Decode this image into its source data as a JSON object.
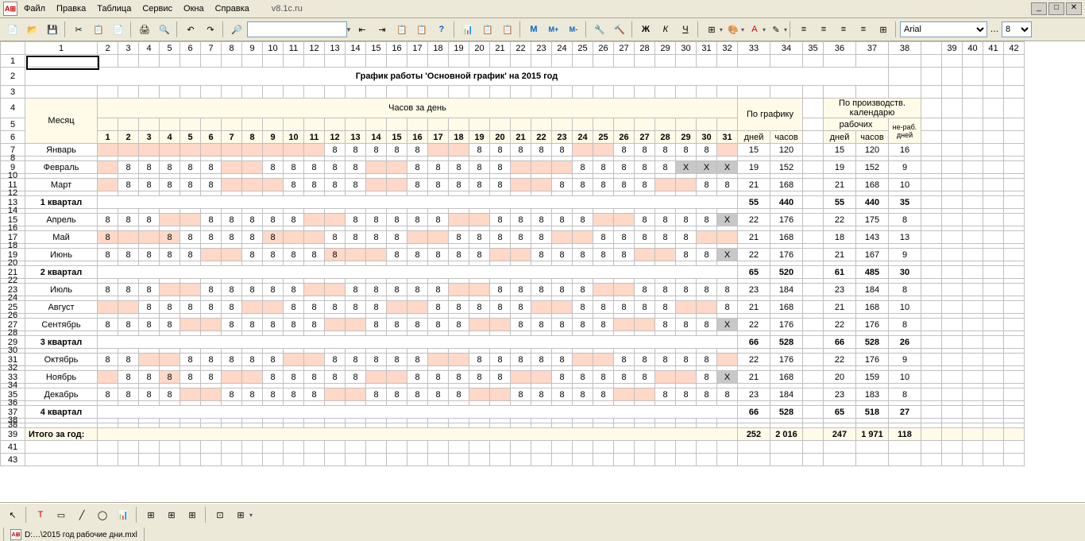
{
  "menu": [
    "Файл",
    "Правка",
    "Таблица",
    "Сервис",
    "Окна",
    "Справка"
  ],
  "url": "v8.1c.ru",
  "toolbar": {
    "font": "Arial",
    "size": "8",
    "btns1": [
      "📄",
      "📂",
      "💾",
      "✂",
      "📋",
      "📄",
      "🖨",
      "🔍"
    ],
    "btns2": [
      "↶",
      "↷"
    ],
    "btns3": [
      "🔍",
      "",
      "🔎",
      "🔎",
      "📋",
      "📋",
      "?"
    ],
    "btns4": [
      "📊",
      "📋",
      "📋"
    ],
    "btns5": [
      "M",
      "M+",
      "M-"
    ],
    "btns6": [
      "🔧",
      "🔨"
    ],
    "fmt": [
      "Ж",
      "К",
      "Ч"
    ],
    "align": [
      "≡",
      "≡",
      "≡",
      "≡",
      "≡"
    ]
  },
  "title": "График работы 'Основной график' на 2015 год",
  "headers": {
    "month": "Месяц",
    "hoursPerDay": "Часов за день",
    "bySchedule": "По графику",
    "byCalendar": "По производств. календарю",
    "workDays": "рабочих",
    "nonWork": "не-раб. дней",
    "days": "дней",
    "hours": "часов"
  },
  "dayNums": [
    "1",
    "2",
    "3",
    "4",
    "5",
    "6",
    "7",
    "8",
    "9",
    "10",
    "11",
    "12",
    "13",
    "14",
    "15",
    "16",
    "17",
    "18",
    "19",
    "20",
    "21",
    "22",
    "23",
    "24",
    "25",
    "26",
    "27",
    "28",
    "29",
    "30",
    "31"
  ],
  "months": [
    {
      "r": "7",
      "name": "Январь",
      "cells": [
        "w",
        "w",
        "w",
        "w",
        "w",
        "w",
        "w",
        "w",
        "w",
        "w",
        "w",
        "8",
        "8",
        "8",
        "8",
        "8",
        "w",
        "w",
        "8",
        "8",
        "8",
        "8",
        "8",
        "w",
        "w",
        "8",
        "8",
        "8",
        "8",
        "8",
        "w"
      ],
      "s1": [
        "15",
        "120"
      ],
      "s2": [
        "15",
        "120",
        "16"
      ]
    },
    {
      "r": "9",
      "name": "Февраль",
      "cells": [
        "w",
        "8",
        "8",
        "8",
        "8",
        "8",
        "w",
        "w",
        "8",
        "8",
        "8",
        "8",
        "8",
        "w",
        "w",
        "8",
        "8",
        "8",
        "8",
        "8",
        "w",
        "w",
        "w",
        "8",
        "8",
        "8",
        "8",
        "8",
        "X",
        "X",
        "X"
      ],
      "s1": [
        "19",
        "152"
      ],
      "s2": [
        "19",
        "152",
        "9"
      ]
    },
    {
      "r": "11",
      "name": "Март",
      "cells": [
        "w",
        "8",
        "8",
        "8",
        "8",
        "8",
        "w",
        "w",
        "w",
        "8",
        "8",
        "8",
        "8",
        "w",
        "w",
        "8",
        "8",
        "8",
        "8",
        "8",
        "w",
        "w",
        "8",
        "8",
        "8",
        "8",
        "8",
        "w",
        "w",
        "8",
        "8"
      ],
      "s1": [
        "21",
        "168"
      ],
      "s2": [
        "21",
        "168",
        "10"
      ]
    }
  ],
  "q1": {
    "r": "13",
    "name": "1 квартал",
    "s1": [
      "55",
      "440"
    ],
    "s2": [
      "55",
      "440",
      "35"
    ]
  },
  "months2": [
    {
      "r": "15",
      "name": "Апрель",
      "cells": [
        "8",
        "8",
        "8",
        "w",
        "w",
        "8",
        "8",
        "8",
        "8",
        "8",
        "w",
        "w",
        "8",
        "8",
        "8",
        "8",
        "8",
        "w",
        "w",
        "8",
        "8",
        "8",
        "8",
        "8",
        "w",
        "w",
        "8",
        "8",
        "8",
        "8",
        "X"
      ],
      "s1": [
        "22",
        "176"
      ],
      "s2": [
        "22",
        "175",
        "8"
      ]
    },
    {
      "r": "17",
      "name": "Май",
      "cells": [
        "r8",
        "w",
        "w",
        "r8",
        "8",
        "8",
        "8",
        "8",
        "r8",
        "w",
        "w",
        "8",
        "8",
        "8",
        "8",
        "w",
        "w",
        "8",
        "8",
        "8",
        "8",
        "8",
        "w",
        "w",
        "8",
        "8",
        "8",
        "8",
        "8",
        "w",
        "w"
      ],
      "s1": [
        "21",
        "168"
      ],
      "s2": [
        "18",
        "143",
        "13"
      ]
    },
    {
      "r": "19",
      "name": "Июнь",
      "cells": [
        "8",
        "8",
        "8",
        "8",
        "8",
        "w",
        "w",
        "8",
        "8",
        "8",
        "8",
        "r8",
        "w",
        "w",
        "8",
        "8",
        "8",
        "8",
        "8",
        "w",
        "w",
        "8",
        "8",
        "8",
        "8",
        "8",
        "w",
        "w",
        "8",
        "8",
        "X"
      ],
      "s1": [
        "22",
        "176"
      ],
      "s2": [
        "21",
        "167",
        "9"
      ]
    }
  ],
  "q2": {
    "r": "21",
    "name": "2 квартал",
    "s1": [
      "65",
      "520"
    ],
    "s2": [
      "61",
      "485",
      "30"
    ]
  },
  "months3": [
    {
      "r": "23",
      "name": "Июль",
      "cells": [
        "8",
        "8",
        "8",
        "w",
        "w",
        "8",
        "8",
        "8",
        "8",
        "8",
        "w",
        "w",
        "8",
        "8",
        "8",
        "8",
        "8",
        "w",
        "w",
        "8",
        "8",
        "8",
        "8",
        "8",
        "w",
        "w",
        "8",
        "8",
        "8",
        "8",
        "8"
      ],
      "s1": [
        "23",
        "184"
      ],
      "s2": [
        "23",
        "184",
        "8"
      ]
    },
    {
      "r": "25",
      "name": "Август",
      "cells": [
        "w",
        "w",
        "8",
        "8",
        "8",
        "8",
        "8",
        "w",
        "w",
        "8",
        "8",
        "8",
        "8",
        "8",
        "w",
        "w",
        "8",
        "8",
        "8",
        "8",
        "8",
        "w",
        "w",
        "8",
        "8",
        "8",
        "8",
        "8",
        "w",
        "w",
        "8"
      ],
      "s1": [
        "21",
        "168"
      ],
      "s2": [
        "21",
        "168",
        "10"
      ]
    },
    {
      "r": "27",
      "name": "Сентябрь",
      "cells": [
        "8",
        "8",
        "8",
        "8",
        "w",
        "w",
        "8",
        "8",
        "8",
        "8",
        "8",
        "w",
        "w",
        "8",
        "8",
        "8",
        "8",
        "8",
        "w",
        "w",
        "8",
        "8",
        "8",
        "8",
        "8",
        "w",
        "w",
        "8",
        "8",
        "8",
        "X"
      ],
      "s1": [
        "22",
        "176"
      ],
      "s2": [
        "22",
        "176",
        "8"
      ]
    }
  ],
  "q3": {
    "r": "29",
    "name": "3 квартал",
    "s1": [
      "66",
      "528"
    ],
    "s2": [
      "66",
      "528",
      "26"
    ]
  },
  "months4": [
    {
      "r": "31",
      "name": "Октябрь",
      "cells": [
        "8",
        "8",
        "w",
        "w",
        "8",
        "8",
        "8",
        "8",
        "8",
        "w",
        "w",
        "8",
        "8",
        "8",
        "8",
        "8",
        "w",
        "w",
        "8",
        "8",
        "8",
        "8",
        "8",
        "w",
        "w",
        "8",
        "8",
        "8",
        "8",
        "8",
        "w"
      ],
      "s1": [
        "22",
        "176"
      ],
      "s2": [
        "22",
        "176",
        "9"
      ]
    },
    {
      "r": "33",
      "name": "Ноябрь",
      "cells": [
        "w",
        "8",
        "8",
        "r8",
        "8",
        "8",
        "w",
        "w",
        "8",
        "8",
        "8",
        "8",
        "8",
        "w",
        "w",
        "8",
        "8",
        "8",
        "8",
        "8",
        "w",
        "w",
        "8",
        "8",
        "8",
        "8",
        "8",
        "w",
        "w",
        "8",
        "X"
      ],
      "s1": [
        "21",
        "168"
      ],
      "s2": [
        "20",
        "159",
        "10"
      ]
    },
    {
      "r": "35",
      "name": "Декабрь",
      "cells": [
        "8",
        "8",
        "8",
        "8",
        "w",
        "w",
        "8",
        "8",
        "8",
        "8",
        "8",
        "w",
        "w",
        "8",
        "8",
        "8",
        "8",
        "8",
        "w",
        "w",
        "8",
        "8",
        "8",
        "8",
        "8",
        "w",
        "w",
        "8",
        "8",
        "8",
        "8"
      ],
      "s1": [
        "23",
        "184"
      ],
      "s2": [
        "23",
        "183",
        "8"
      ]
    }
  ],
  "q4": {
    "r": "37",
    "name": "4 квартал",
    "s1": [
      "66",
      "528"
    ],
    "s2": [
      "65",
      "518",
      "27"
    ]
  },
  "total": {
    "r": "39",
    "name": "Итого за год:",
    "s1": [
      "252",
      "2 016"
    ],
    "s2": [
      "247",
      "1 971",
      "118"
    ]
  },
  "emptyRows": [
    "41",
    "43"
  ],
  "colHdrs": [
    "",
    "1",
    "2",
    "3",
    "4",
    "5",
    "6",
    "7",
    "8",
    "9",
    "10",
    "11",
    "12",
    "13",
    "14",
    "15",
    "16",
    "17",
    "18",
    "19",
    "20",
    "21",
    "22",
    "23",
    "24",
    "25",
    "26",
    "27",
    "28",
    "29",
    "30",
    "31",
    "32",
    "33",
    "34",
    "35",
    "36",
    "37",
    "38",
    "",
    "39",
    "40",
    "41",
    "42"
  ],
  "tab": "D:…\\2015 год рабочие дни.mxl"
}
